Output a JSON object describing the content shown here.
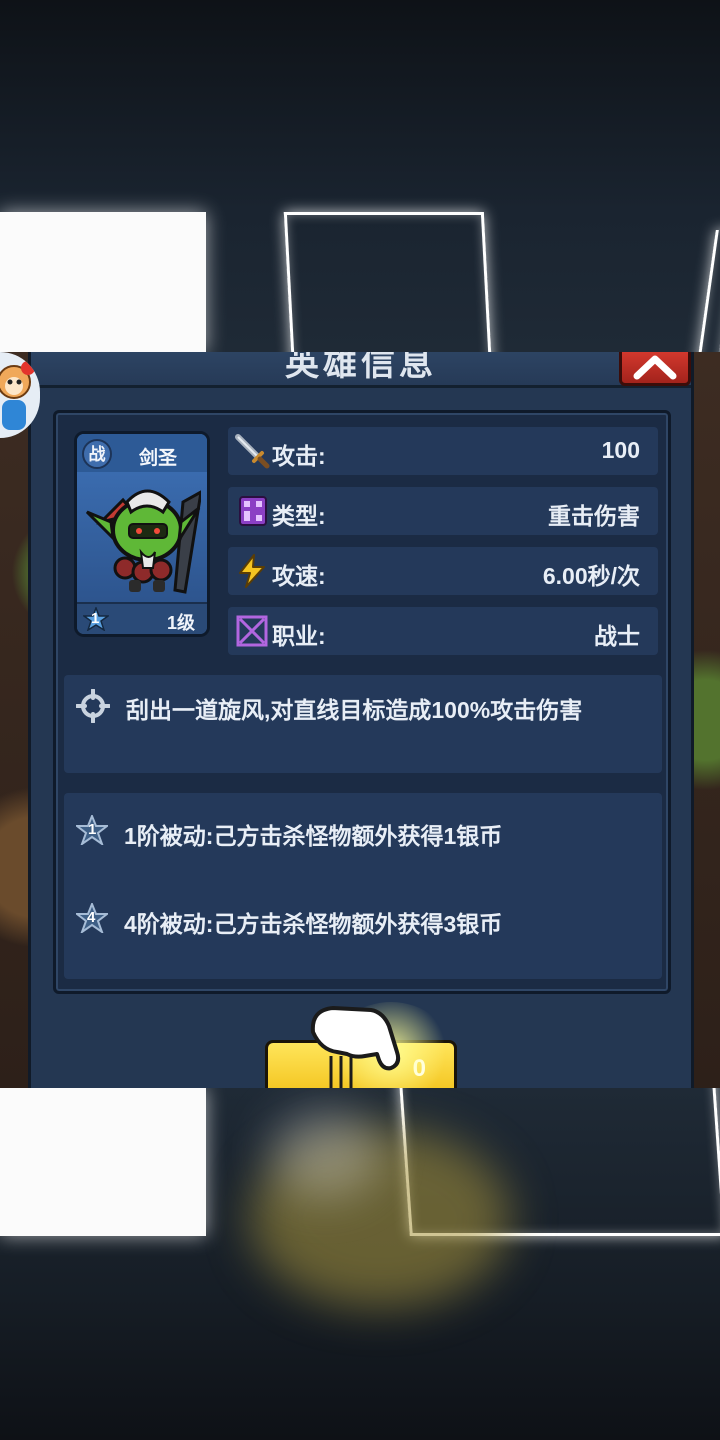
{
  "dialog": {
    "title": "英雄信息",
    "close_label": "×"
  },
  "hero": {
    "class_badge": "战",
    "name": "剑圣",
    "star_rank": "1",
    "level": "1级"
  },
  "stats": [
    {
      "label": "攻击:",
      "value": "100",
      "icon": "sword-icon"
    },
    {
      "label": "类型:",
      "value": "重击伤害",
      "icon": "damage-type-icon"
    },
    {
      "label": "攻速:",
      "value": "6.00秒/次",
      "icon": "lightning-icon"
    },
    {
      "label": "职业:",
      "value": "战士",
      "icon": "crossed-swords-icon"
    }
  ],
  "skill": {
    "icon": "crosshair-icon",
    "description": "刮出一道旋风,对直线目标造成100%攻击伤害"
  },
  "passives": [
    {
      "rank": "1",
      "text": "1阶被动:己方击杀怪物额外获得1银币"
    },
    {
      "rank": "4",
      "text": "4阶被动:己方击杀怪物额外获得3银币"
    }
  ],
  "action_button": {
    "label": "0"
  },
  "colors": {
    "panel": "#243752",
    "inner_panel": "#1b2b44",
    "row": "#24395a",
    "close_red": "#d73a2f",
    "button_yellow": "#f2c21b",
    "card_blue": "#3e72b8"
  }
}
